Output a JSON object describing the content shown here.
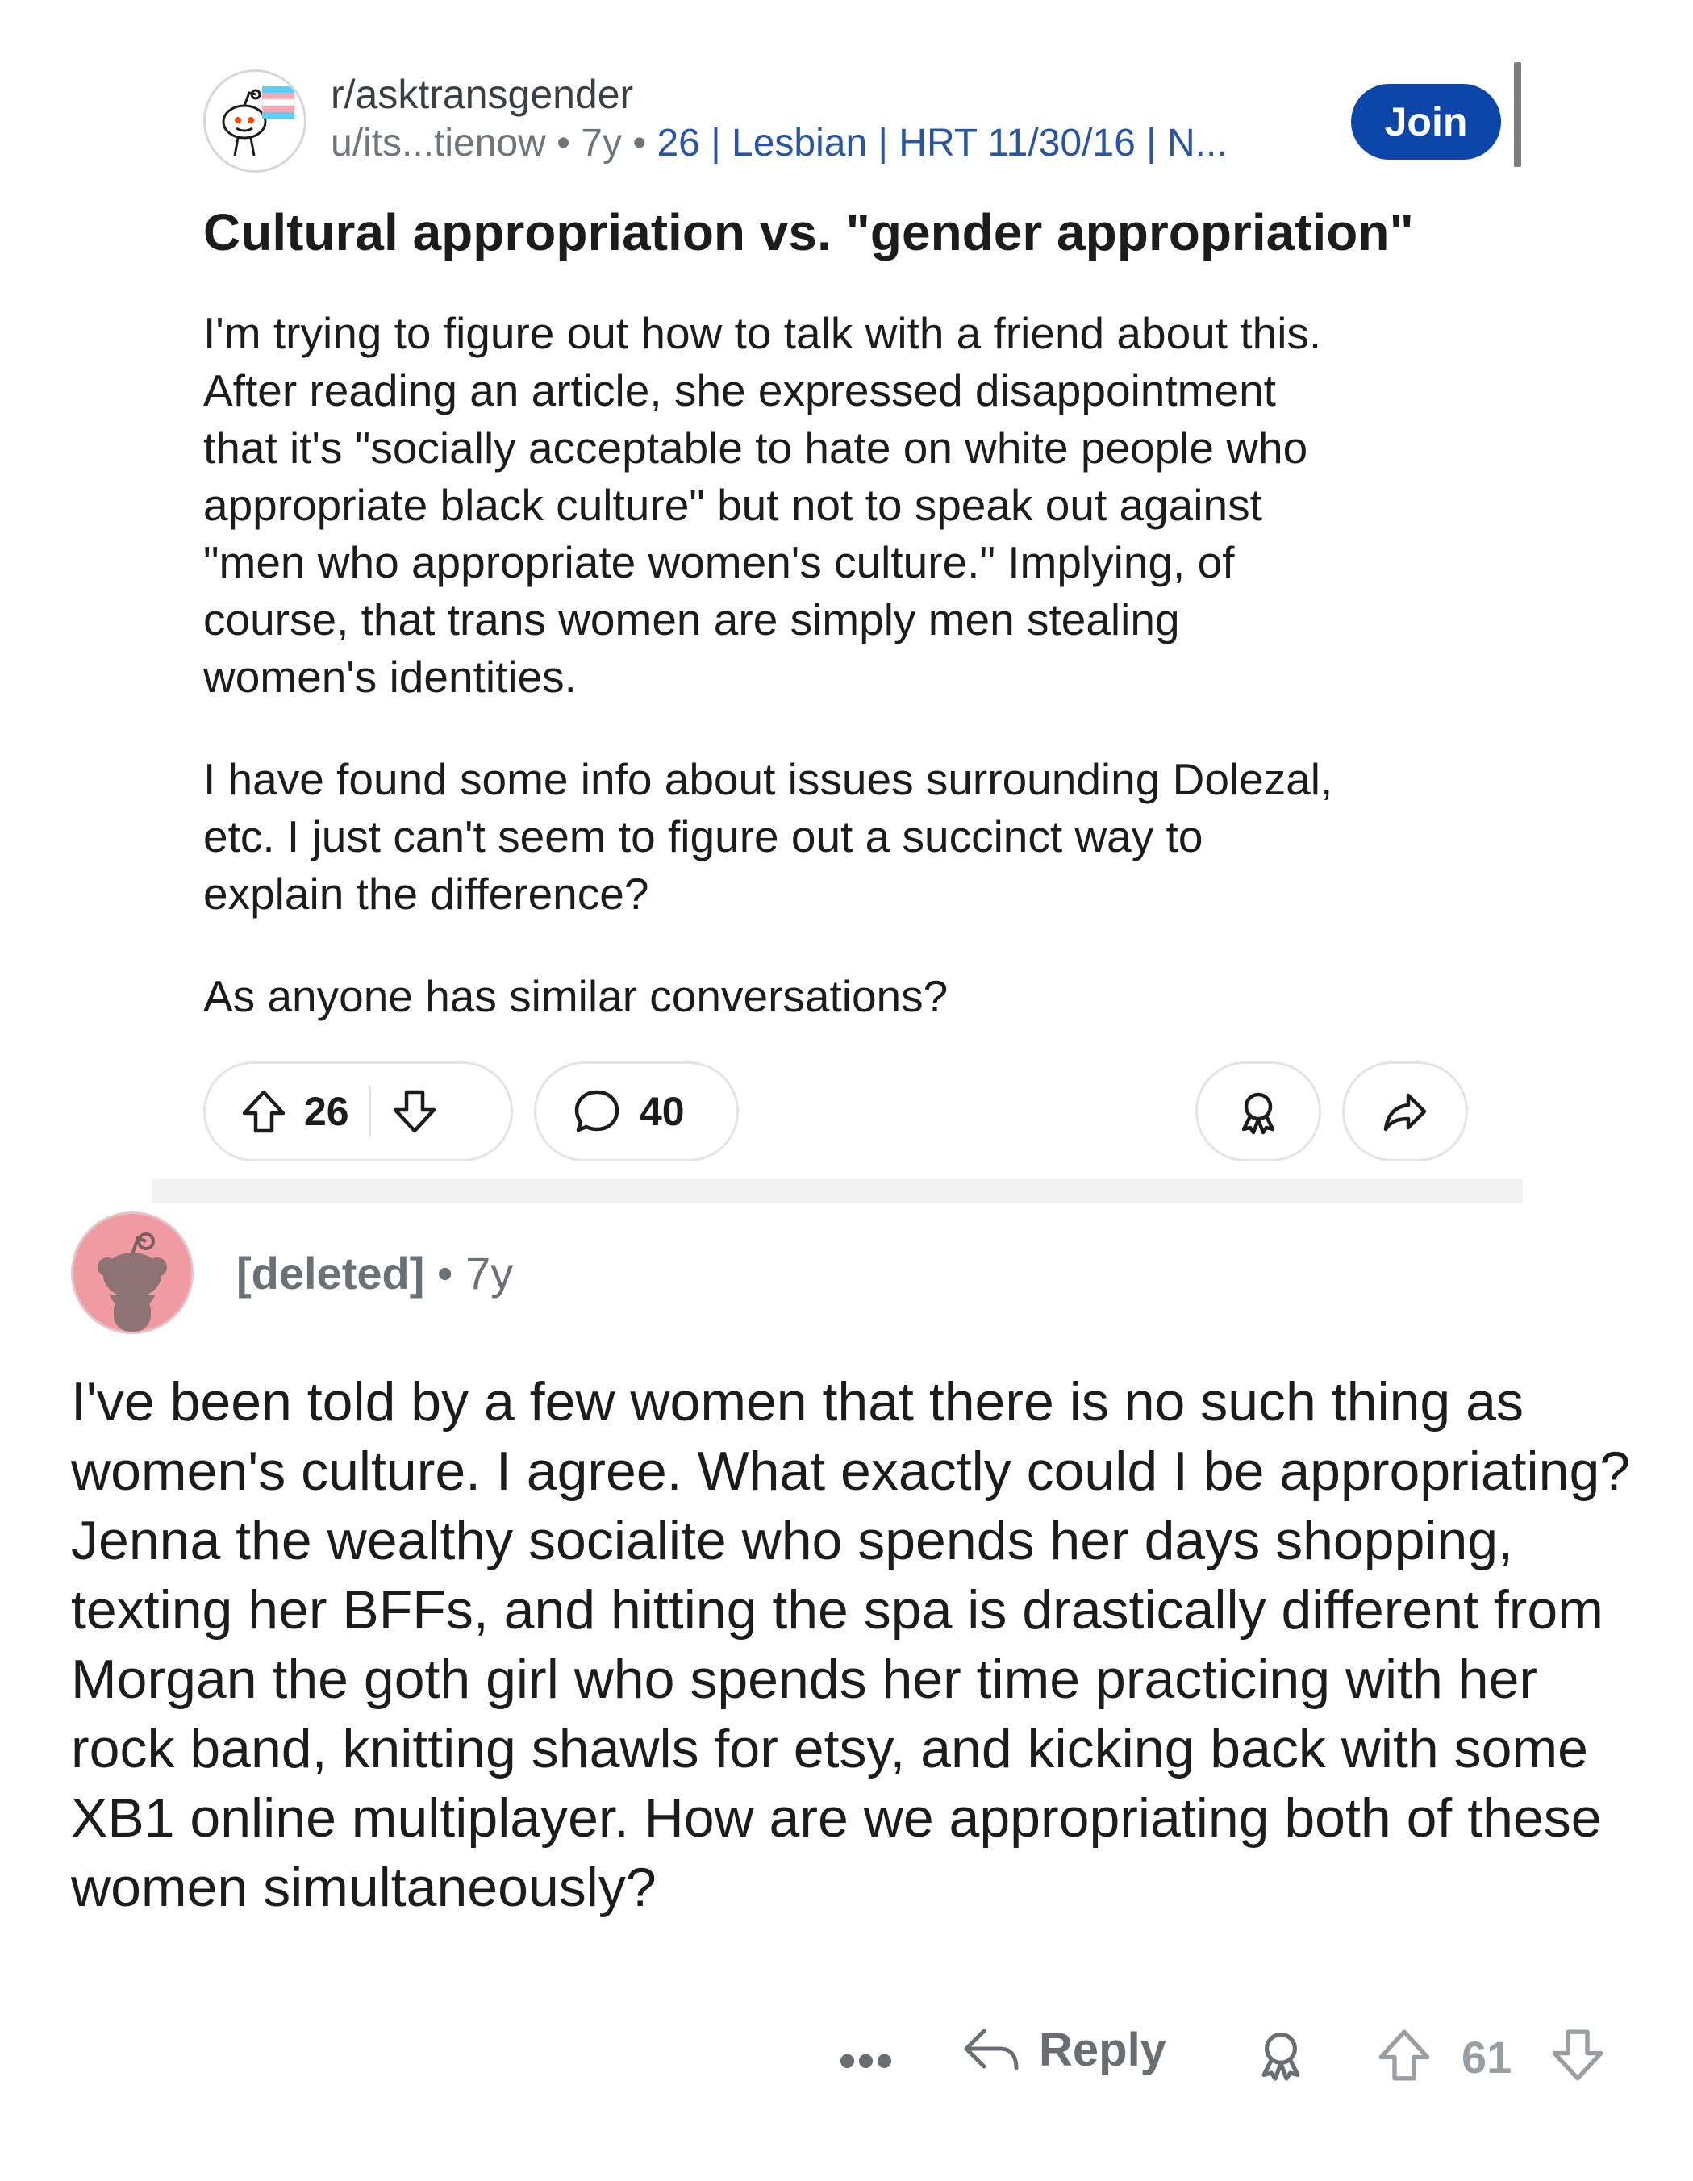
{
  "post": {
    "subreddit": "r/asktransgender",
    "author": "u/its...tienow",
    "age": "7y",
    "flair": "26 | Lesbian | HRT 11/30/16 | N...",
    "join_label": "Join",
    "title": "Cultural appropriation vs. \"gender appropriation\"",
    "paragraphs": [
      "I'm trying to figure out how to talk with a friend about this.\nAfter reading an article, she expressed disappointment\nthat it's \"socially acceptable to hate on white people who\nappropriate black culture\" but not to speak out against\n\"men who appropriate women's culture.\" Implying, of\ncourse, that trans women are simply men stealing\nwomen's identities.",
      "I have found some info about issues surrounding Dolezal,\netc. I just can't seem to figure out a succinct way to\nexplain the difference?",
      "As anyone has similar conversations?"
    ],
    "upvotes": "26",
    "comments": "40",
    "icons": {
      "upvote": "upvote-arrow-icon",
      "downvote": "downvote-arrow-icon",
      "comment": "comment-bubble-icon",
      "award": "award-icon",
      "share": "share-arrow-icon"
    }
  },
  "comment": {
    "author": "[deleted]",
    "separator": "•",
    "age": "7y",
    "body": "I've been told by a few women that there is no such thing as women's culture. I agree. What exactly could I be appropriating? Jenna the wealthy socialite who spends her days shopping, texting her BFFs, and hitting the spa is drastically different from Morgan the goth girl who spends her time practicing with her rock band, knitting shawls for etsy, and kicking back with some XB1 online multiplayer. How are we appropriating both of these women simultaneously?",
    "more_label": "•••",
    "reply_label": "Reply",
    "score": "61"
  },
  "colors": {
    "join_bg": "#0b46a8",
    "flair_blue": "#2a55a3",
    "muted": "#707579",
    "avatar_pink": "#f09aa2"
  }
}
